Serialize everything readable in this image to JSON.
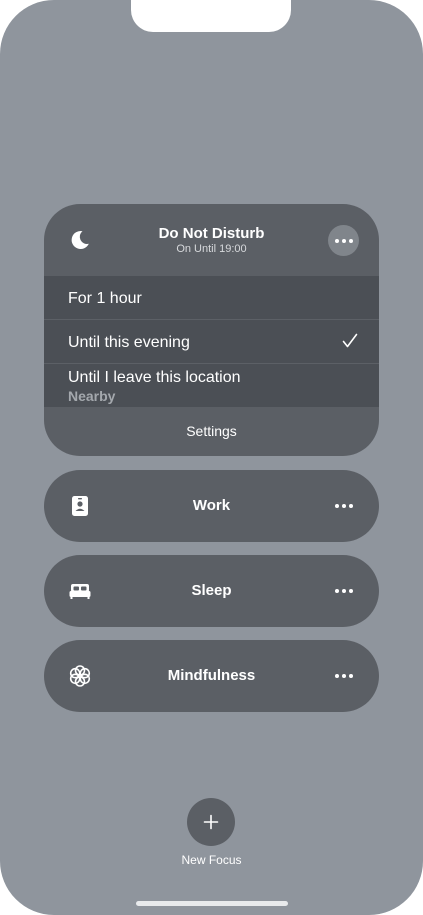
{
  "dnd": {
    "title": "Do Not Disturb",
    "subtitle": "On Until 19:00",
    "icon": "moon-icon",
    "options": [
      {
        "label": "For 1 hour"
      },
      {
        "label": "Until this evening",
        "selected": true
      },
      {
        "label": "Until I leave this location",
        "sublabel": "Nearby"
      }
    ],
    "settings_label": "Settings"
  },
  "focus_modes": [
    {
      "label": "Work",
      "icon": "id-badge-icon"
    },
    {
      "label": "Sleep",
      "icon": "bed-icon"
    },
    {
      "label": "Mindfulness",
      "icon": "flower-icon"
    }
  ],
  "new_focus": {
    "label": "New Focus",
    "icon": "plus-icon"
  },
  "colors": {
    "background": "#8f959d",
    "card": "#5b5f65",
    "options_bg": "#4b4f55"
  }
}
